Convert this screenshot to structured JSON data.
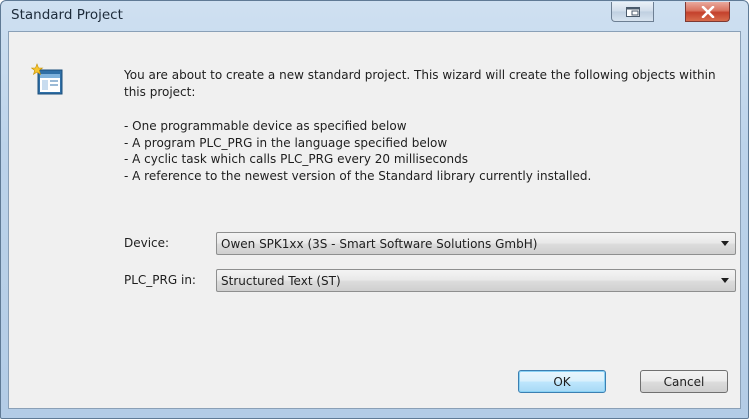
{
  "window": {
    "title": "Standard Project"
  },
  "titlebar_buttons": {
    "restore_icon": "restore-icon",
    "close_glyph": "X"
  },
  "wizard": {
    "icon": "wizard-project-icon",
    "intro": "You are about to create a new standard project. This wizard will create the following objects within this project:",
    "bullets": [
      "- One programmable device as specified below",
      "- A program PLC_PRG in the language specified below",
      "- A cyclic task which calls PLC_PRG every 20 milliseconds",
      "- A reference to the newest version of the Standard library currently installed."
    ]
  },
  "form": {
    "device_label": "Device:",
    "device_value": "Owen SPK1xx (3S - Smart Software Solutions GmbH)",
    "language_label": "PLC_PRG in:",
    "language_value": "Structured Text (ST)"
  },
  "buttons": {
    "ok": "OK",
    "cancel": "Cancel"
  },
  "colors": {
    "title_bar": "#bcd3ea",
    "client_background": "#f0f0f0",
    "close_button": "#c4412c",
    "default_button_border": "#3c7fb1"
  }
}
